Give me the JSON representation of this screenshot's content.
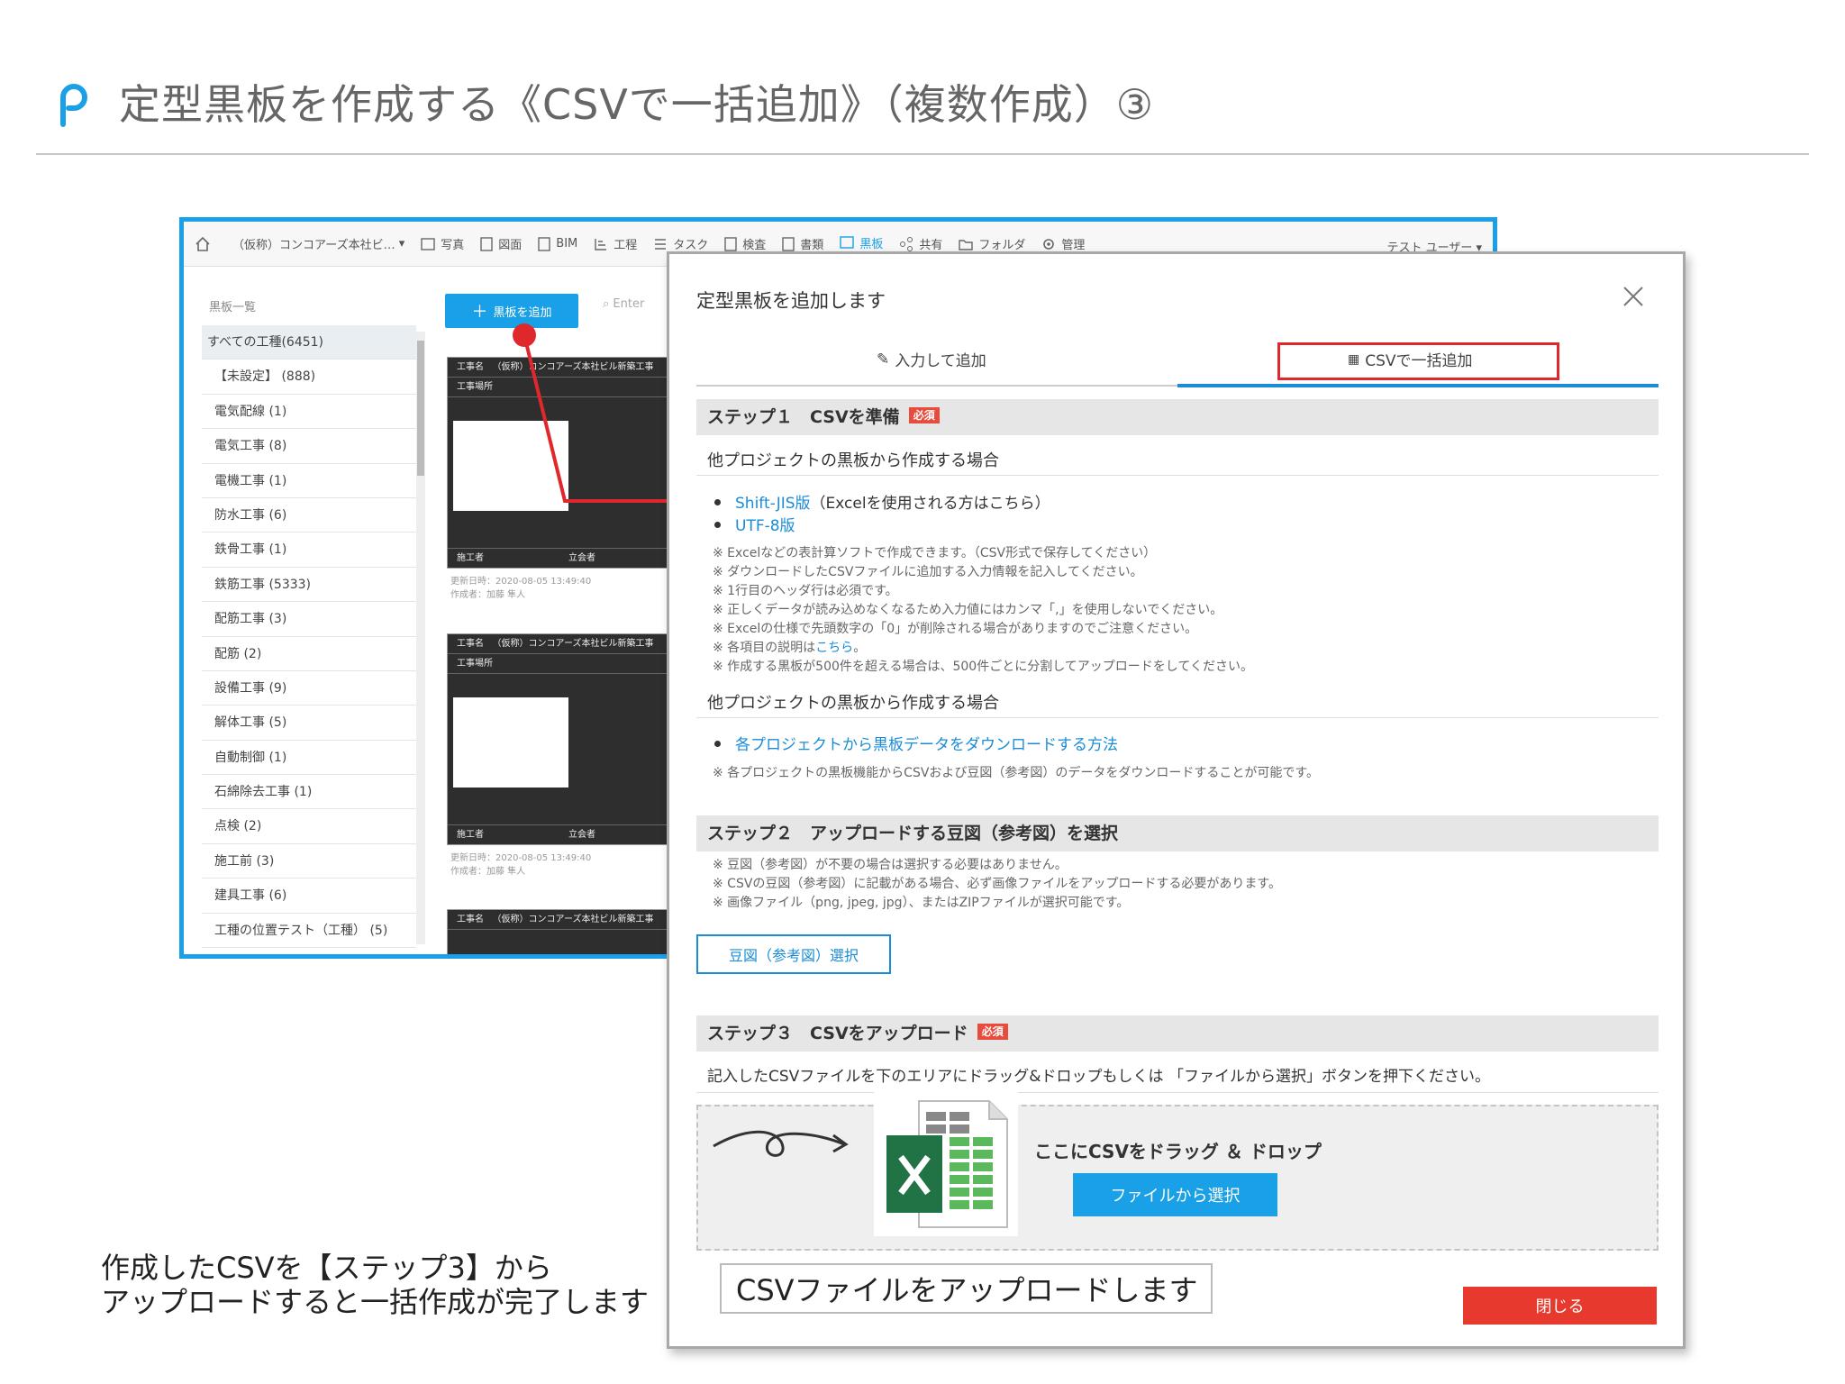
{
  "slide": {
    "title": "定型黒板を作成する《CSVで一括追加》（複数作成）③",
    "caption_line1": "作成したCSVを【ステップ3】から",
    "caption_line2": "アップロードすると一括作成が完了します",
    "callout": "CSVファイルをアップロードします"
  },
  "app": {
    "project": "（仮称）コンコアーズ本社ビ…",
    "nav": [
      "写真",
      "図面",
      "BIM",
      "工程",
      "タスク",
      "検査",
      "書類",
      "黒板",
      "共有",
      "フォルダ",
      "管理"
    ],
    "active_nav": "黒板",
    "user": "テスト ユーザー",
    "sidebar_heading": "黒板一覧",
    "sidebar_items": [
      "すべての工種(6451)",
      "【未設定】 (888)",
      "電気配線 (1)",
      "電気工事 (8)",
      "電機工事 (1)",
      "防水工事 (6)",
      "鉄骨工事 (1)",
      "鉄筋工事 (5333)",
      "配筋工事 (3)",
      "配筋 (2)",
      "設備工事 (9)",
      "解体工事 (5)",
      "自動制御 (1)",
      "石綿除去工事 (1)",
      "点検 (2)",
      "施工前 (3)",
      "建具工事 (6)",
      "工種の位置テスト（工種） (5)"
    ],
    "add_button": "黒板を追加",
    "search_placeholder": "Enter",
    "boards": [
      {
        "row1_label": "工事名",
        "row1_value": "（仮称）コンコアーズ本社ビル新築工事",
        "row2_label": "工事場所",
        "foot_left": "施工者",
        "foot_right": "立会者",
        "meta1": "更新日時：2020-08-05 13:49:40",
        "meta2": "作成者：加藤 隼人"
      },
      {
        "row1_label": "工事名",
        "row1_value": "（仮称）コンコアーズ本社ビル新築工事",
        "row2_label": "工事場所",
        "foot_left": "施工者",
        "foot_right": "立会者",
        "meta1": "更新日時：2020-08-05 13:49:40",
        "meta2": "作成者：加藤 隼人"
      },
      {
        "row1_label": "工事名",
        "row1_value": "（仮称）コンコアーズ本社ビル新築工事"
      }
    ]
  },
  "modal": {
    "title": "定型黒板を追加します",
    "tab_manual": "入力して追加",
    "tab_csv": "CSVで一括追加",
    "required_badge": "必須",
    "step1": {
      "title": "ステップ１　CSVを準備",
      "sub1": "他プロジェクトの黒板から作成する場合",
      "link_sjis": "Shift-JIS版",
      "link_sjis_suffix": "（Excelを使用される方はこちら）",
      "link_utf8": "UTF-8版",
      "notes": [
        "※ Excelなどの表計算ソフトで作成できます。（CSV形式で保存してください）",
        "※ ダウンロードしたCSVファイルに追加する入力情報を記入してください。",
        "※ 1行目のヘッダ行は必須です。",
        "※ 正しくデータが読み込めなくなるため入力値にはカンマ「,」を使用しないでください。",
        "※ Excelの仕様で先頭数字の「0」が削除される場合がありますのでご注意ください。",
        "※ 作成する黒板が500件を超える場合は、500件ごとに分割してアップロードをしてください。"
      ],
      "note_link_prefix": "※ 各項目の説明は",
      "note_link": "こちら",
      "note_link_suffix": "。",
      "sub2": "他プロジェクトの黒板から作成する場合",
      "link_download": "各プロジェクトから黒板データをダウンロードする方法",
      "note_download": "※ 各プロジェクトの黒板機能からCSVおよび豆図（参考図）のデータをダウンロードすることが可能です。"
    },
    "step2": {
      "title": "ステップ２　アップロードする豆図（参考図）を選択",
      "notes": [
        "※ 豆図（参考図）が不要の場合は選択する必要はありません。",
        "※ CSVの豆図（参考図）に記載がある場合、必ず画像ファイルをアップロードする必要があります。",
        "※ 画像ファイル（png, jpeg, jpg）、またはZIPファイルが選択可能です。"
      ],
      "button": "豆図（参考図）選択"
    },
    "step3": {
      "title": "ステップ３　CSVをアップロード",
      "instruction": "記入したCSVファイルを下のエリアにドラッグ&ドロップもしくは 「ファイルから選択」ボタンを押下ください。",
      "drop_text": "ここにCSVをドラッグ ＆ ドロップ",
      "file_button": "ファイルから選択"
    },
    "close_button": "閉じる"
  },
  "colors": {
    "accent_blue": "#1aa0e6",
    "link_blue": "#1a8cd8",
    "highlight_red": "#e0282c",
    "close_red": "#e8392e",
    "excel_green": "#217346"
  }
}
